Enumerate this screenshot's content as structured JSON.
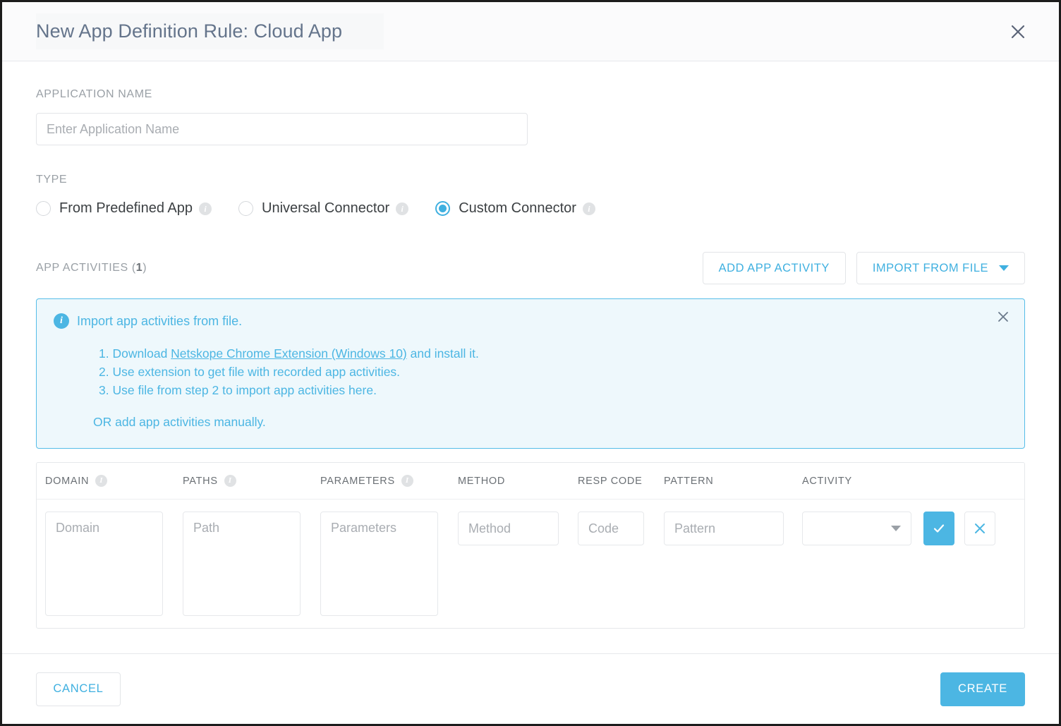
{
  "dialog": {
    "title": "New App Definition Rule: Cloud App",
    "close_icon": "close-icon"
  },
  "form": {
    "app_name_label": "APPLICATION NAME",
    "app_name_value": "",
    "app_name_placeholder": "Enter Application Name",
    "type_label": "TYPE",
    "type_options": [
      {
        "label": "From Predefined App",
        "selected": false,
        "info": "i"
      },
      {
        "label": "Universal Connector",
        "selected": false,
        "info": "i"
      },
      {
        "label": "Custom Connector",
        "selected": true,
        "info": "i"
      }
    ]
  },
  "activities": {
    "title_text": "APP ACTIVITIES (",
    "count": "1",
    "title_suffix": ")",
    "add_button": "ADD APP ACTIVITY",
    "import_button": "IMPORT FROM FILE"
  },
  "banner": {
    "heading": "Import app activities from file.",
    "steps": [
      {
        "num": "1. ",
        "pre": "Download ",
        "link": "Netskope Chrome Extension (Windows 10)",
        "post": " and install it."
      },
      {
        "num": "2. ",
        "pre": "Use extension to get file with recorded app activities.",
        "link": "",
        "post": ""
      },
      {
        "num": "3. ",
        "pre": "Use file from step 2 to import app activities here.",
        "link": "",
        "post": ""
      }
    ],
    "or_text": "OR add app activities manually.",
    "close_icon": "close-icon",
    "accent_color": "#4cb6e3",
    "background_color": "#eef8fc"
  },
  "table": {
    "columns": [
      {
        "key": "domain",
        "label": "DOMAIN",
        "has_info": true
      },
      {
        "key": "paths",
        "label": "PATHS",
        "has_info": true
      },
      {
        "key": "parameters",
        "label": "PARAMETERS",
        "has_info": true
      },
      {
        "key": "method",
        "label": "METHOD",
        "has_info": false
      },
      {
        "key": "resp_code",
        "label": "RESP CODE",
        "has_info": false
      },
      {
        "key": "pattern",
        "label": "PATTERN",
        "has_info": false
      },
      {
        "key": "activity",
        "label": "ACTIVITY",
        "has_info": false
      }
    ],
    "row": {
      "domain_value": "",
      "domain_placeholder": "Domain",
      "paths_value": "",
      "paths_placeholder": "Path",
      "parameters_value": "",
      "parameters_placeholder": "Parameters",
      "method_value": "",
      "method_placeholder": "Method",
      "resp_code_value": "",
      "resp_code_placeholder": "Code",
      "pattern_value": "",
      "pattern_placeholder": "Pattern",
      "activity_value": "",
      "confirm_icon": "check-icon",
      "cancel_icon": "close-icon"
    }
  },
  "footer": {
    "cancel_label": "CANCEL",
    "create_label": "CREATE"
  },
  "theme": {
    "accent": "#4cb6e3",
    "link": "#3fb0e0",
    "title_color": "#64748b",
    "label_color": "#9aa0a6"
  }
}
